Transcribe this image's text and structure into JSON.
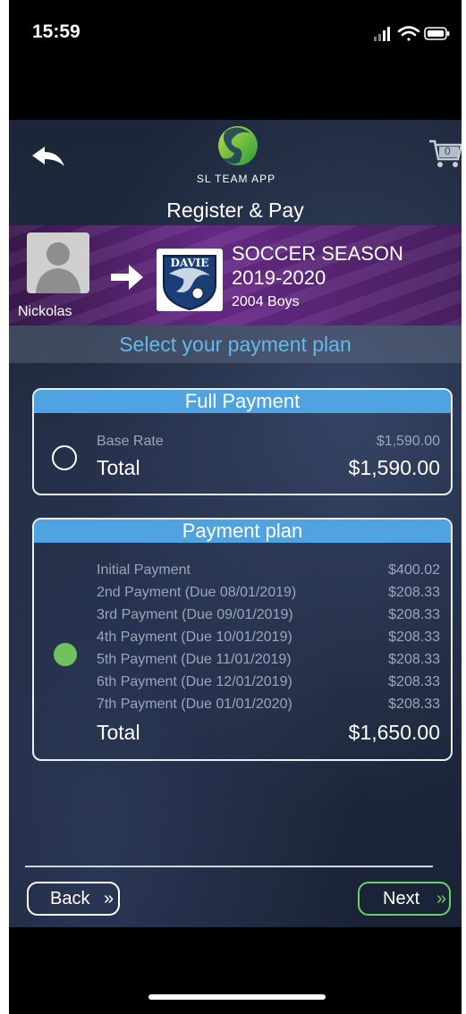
{
  "status": {
    "time": "15:59"
  },
  "header": {
    "title": "Register & Pay",
    "logo_text": "SL TEAM APP",
    "cart_count": "0"
  },
  "banner": {
    "member_name": "Nickolas",
    "team_logo_text": "DAVIE",
    "season_line1": "SOCCER SEASON",
    "season_line2": "2019-2020",
    "group": "2004 Boys"
  },
  "select_prompt": "Select your payment plan",
  "full_payment": {
    "title": "Full Payment",
    "rows": [
      {
        "label": "Base Rate",
        "value": "$1,590.00"
      }
    ],
    "total_label": "Total",
    "total_value": "$1,590.00",
    "selected": false
  },
  "payment_plan": {
    "title": "Payment plan",
    "rows": [
      {
        "label": "Initial Payment",
        "value": "$400.02"
      },
      {
        "label": "2nd Payment (Due 08/01/2019)",
        "value": "$208.33"
      },
      {
        "label": "3rd Payment (Due 09/01/2019)",
        "value": "$208.33"
      },
      {
        "label": "4th Payment (Due 10/01/2019)",
        "value": "$208.33"
      },
      {
        "label": "5th Payment (Due 11/01/2019)",
        "value": "$208.33"
      },
      {
        "label": "6th Payment (Due 12/01/2019)",
        "value": "$208.33"
      },
      {
        "label": "7th Payment (Due 01/01/2020)",
        "value": "$208.33"
      }
    ],
    "total_label": "Total",
    "total_value": "$1,650.00",
    "selected": true
  },
  "footer": {
    "back_label": "Back",
    "next_label": "Next",
    "chevron": "»"
  },
  "colors": {
    "accent_blue": "#4fa3e0",
    "select_text": "#61b9ee",
    "selected_green": "#6fc25c",
    "next_border": "#6ccf6a"
  }
}
